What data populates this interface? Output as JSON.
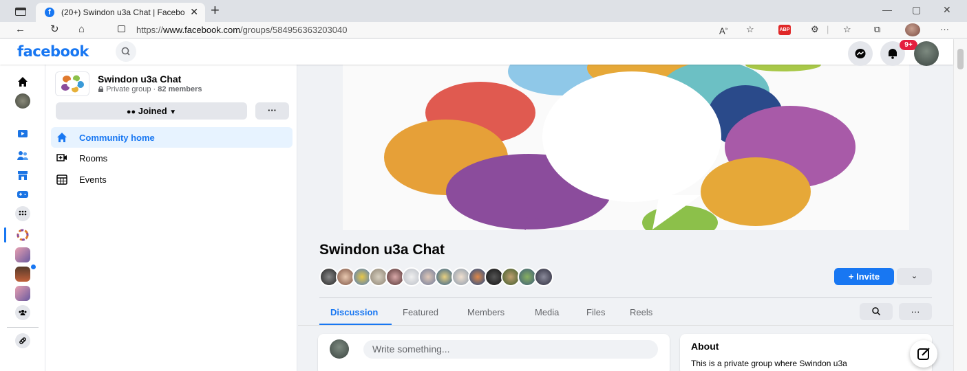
{
  "browser": {
    "tab_title": "(20+) Swindon u3a Chat | Facebo",
    "tab_close": "✕",
    "new_tab": "+",
    "url_prefix": "https://",
    "url_domain": "www.facebook.com",
    "url_path": "/groups/584956363203040",
    "abp_label": "ABP",
    "window_minimize": "—",
    "window_restore": "▢",
    "window_close": "✕"
  },
  "header": {
    "logo": "facebook",
    "notifications_badge": "9+"
  },
  "group": {
    "name": "Swindon u3a Chat",
    "privacy": "Private group",
    "separator": " · ",
    "members_count": "82 members",
    "joined_label": "Joined",
    "more_label": "···",
    "nav": [
      {
        "label": "Community home",
        "icon": "home-icon",
        "active": true
      },
      {
        "label": "Rooms",
        "icon": "rooms-icon",
        "active": false
      },
      {
        "label": "Events",
        "icon": "calendar-icon",
        "active": false
      }
    ],
    "invite_label": "+  Invite",
    "tabs": [
      "Discussion",
      "Featured",
      "Members",
      "Media",
      "Files",
      "Reels"
    ],
    "active_tab": "Discussion"
  },
  "composer": {
    "placeholder": "Write something..."
  },
  "about": {
    "title": "About",
    "text": "This is a private group where Swindon u3a"
  },
  "colors": {
    "brand": "#1877f2",
    "badge": "#e41e3f",
    "active_bg": "#e7f3ff"
  }
}
